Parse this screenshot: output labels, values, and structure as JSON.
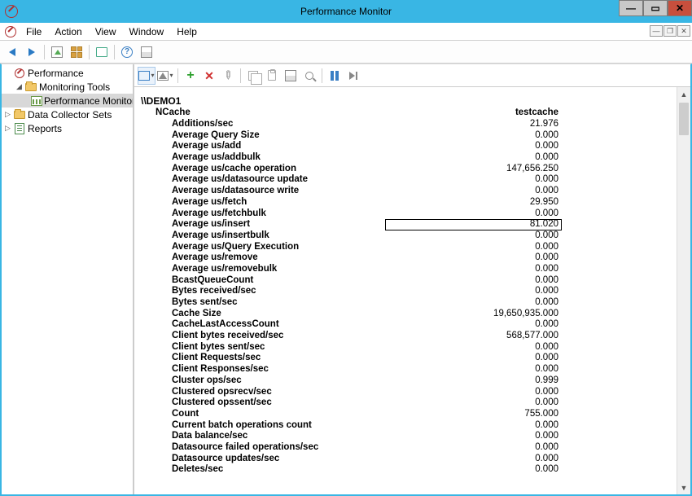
{
  "window": {
    "title": "Performance Monitor"
  },
  "menu": {
    "file": "File",
    "action": "Action",
    "view": "View",
    "window": "Window",
    "help": "Help"
  },
  "tree": {
    "root": "Performance",
    "mon": "Monitoring Tools",
    "perfmon": "Performance Monitor",
    "dcs": "Data Collector Sets",
    "reports": "Reports"
  },
  "report": {
    "host": "\\\\DEMO1",
    "category": "NCache",
    "instance": "testcache",
    "selected_index": 9,
    "counters": [
      {
        "name": "Additions/sec",
        "value": "21.976"
      },
      {
        "name": "Average Query Size",
        "value": "0.000"
      },
      {
        "name": "Average us/add",
        "value": "0.000"
      },
      {
        "name": "Average us/addbulk",
        "value": "0.000"
      },
      {
        "name": "Average us/cache operation",
        "value": "147,656.250"
      },
      {
        "name": "Average us/datasource update",
        "value": "0.000"
      },
      {
        "name": "Average us/datasource write",
        "value": "0.000"
      },
      {
        "name": "Average us/fetch",
        "value": "29.950"
      },
      {
        "name": "Average us/fetchbulk",
        "value": "0.000"
      },
      {
        "name": "Average us/insert",
        "value": "81.020"
      },
      {
        "name": "Average us/insertbulk",
        "value": "0.000"
      },
      {
        "name": "Average us/Query Execution",
        "value": "0.000"
      },
      {
        "name": "Average us/remove",
        "value": "0.000"
      },
      {
        "name": "Average us/removebulk",
        "value": "0.000"
      },
      {
        "name": "BcastQueueCount",
        "value": "0.000"
      },
      {
        "name": "Bytes received/sec",
        "value": "0.000"
      },
      {
        "name": "Bytes sent/sec",
        "value": "0.000"
      },
      {
        "name": "Cache Size",
        "value": "19,650,935.000"
      },
      {
        "name": "CacheLastAccessCount",
        "value": "0.000"
      },
      {
        "name": "Client bytes received/sec",
        "value": "568,577.000"
      },
      {
        "name": "Client bytes sent/sec",
        "value": "0.000"
      },
      {
        "name": "Client Requests/sec",
        "value": "0.000"
      },
      {
        "name": "Client Responses/sec",
        "value": "0.000"
      },
      {
        "name": "Cluster ops/sec",
        "value": "0.999"
      },
      {
        "name": "Clustered opsrecv/sec",
        "value": "0.000"
      },
      {
        "name": "Clustered opssent/sec",
        "value": "0.000"
      },
      {
        "name": "Count",
        "value": "755.000"
      },
      {
        "name": "Current batch operations count",
        "value": "0.000"
      },
      {
        "name": "Data balance/sec",
        "value": "0.000"
      },
      {
        "name": "Datasource failed operations/sec",
        "value": "0.000"
      },
      {
        "name": "Datasource updates/sec",
        "value": "0.000"
      },
      {
        "name": "Deletes/sec",
        "value": "0.000"
      }
    ]
  }
}
